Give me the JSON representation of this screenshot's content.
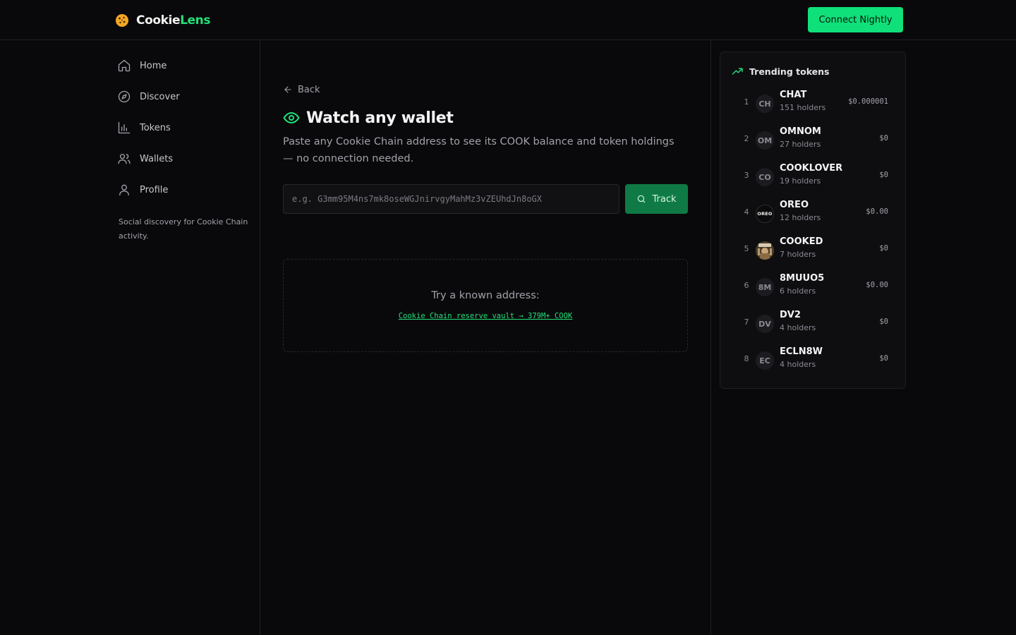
{
  "header": {
    "logo_part1": "Cookie",
    "logo_part2": "Lens",
    "connect_label": "Connect Nightly",
    "brand_color": "#22e07a"
  },
  "sidebar": {
    "items": [
      {
        "label": "Home",
        "icon": "home-icon"
      },
      {
        "label": "Discover",
        "icon": "compass-icon"
      },
      {
        "label": "Tokens",
        "icon": "bar-chart-icon"
      },
      {
        "label": "Wallets",
        "icon": "users-icon"
      },
      {
        "label": "Profile",
        "icon": "user-icon"
      }
    ],
    "tagline": "Social discovery for Cookie Chain activity."
  },
  "main": {
    "back_label": "Back",
    "title": "Watch any wallet",
    "subtitle": "Paste any Cookie Chain address to see its COOK balance and token holdings — no connection needed.",
    "input_placeholder": "e.g. G3mm95M4ns7mk8oseWGJnirvgyMahMz3vZEUhdJn8oGX",
    "input_value": "",
    "track_label": "Track",
    "known_label": "Try a known address:",
    "known_link": "Cookie Chain reserve vault → 379M+ COOK"
  },
  "trending": {
    "title": "Trending tokens",
    "tokens": [
      {
        "rank": "1",
        "avatar": "CH",
        "name": "CHAT",
        "holders": "151 holders",
        "price": "$0.000001"
      },
      {
        "rank": "2",
        "avatar": "OM",
        "name": "OMNOM",
        "holders": "27 holders",
        "price": "$0"
      },
      {
        "rank": "3",
        "avatar": "CO",
        "name": "COOKLOVER",
        "holders": "19 holders",
        "price": "$0"
      },
      {
        "rank": "4",
        "avatar": "OREO",
        "name": "OREO",
        "holders": "12 holders",
        "price": "$0.00"
      },
      {
        "rank": "5",
        "avatar": "",
        "name": "COOKED",
        "holders": "7 holders",
        "price": "$0"
      },
      {
        "rank": "6",
        "avatar": "8M",
        "name": "8MUUO5",
        "holders": "6 holders",
        "price": "$0.00"
      },
      {
        "rank": "7",
        "avatar": "DV",
        "name": "DV2",
        "holders": "4 holders",
        "price": "$0"
      },
      {
        "rank": "8",
        "avatar": "EC",
        "name": "ECLN8W",
        "holders": "4 holders",
        "price": "$0"
      }
    ]
  }
}
